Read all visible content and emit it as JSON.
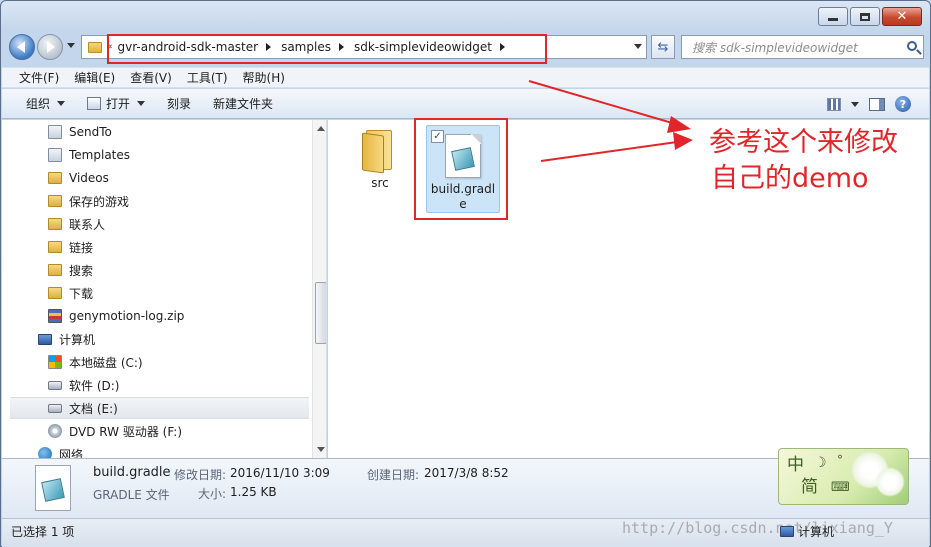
{
  "address": {
    "crumbs": [
      "gvr-android-sdk-master",
      "samples",
      "sdk-simplevideowidget"
    ],
    "overflow_chevron": "«"
  },
  "search": {
    "placeholder": "搜索 sdk-simplevideowidget"
  },
  "menu": [
    "文件(F)",
    "编辑(E)",
    "查看(V)",
    "工具(T)",
    "帮助(H)"
  ],
  "toolbar": {
    "organize": "组织",
    "open": "打开",
    "burn": "刻录",
    "new_folder": "新建文件夹"
  },
  "nav_tree": [
    {
      "label": "SendTo",
      "icon": "shortcut-folder-icon"
    },
    {
      "label": "Templates",
      "icon": "shortcut-folder-icon"
    },
    {
      "label": "Videos",
      "icon": "folder-icon"
    },
    {
      "label": "保存的游戏",
      "icon": "folder-icon"
    },
    {
      "label": "联系人",
      "icon": "folder-icon"
    },
    {
      "label": "链接",
      "icon": "folder-icon"
    },
    {
      "label": "搜索",
      "icon": "folder-icon"
    },
    {
      "label": "下载",
      "icon": "folder-icon"
    },
    {
      "label": "genymotion-log.zip",
      "icon": "zip-icon"
    },
    {
      "label": "计算机",
      "icon": "computer-icon"
    },
    {
      "label": "本地磁盘 (C:)",
      "icon": "windows-drive-icon"
    },
    {
      "label": "软件 (D:)",
      "icon": "drive-icon"
    },
    {
      "label": "文档 (E:)",
      "icon": "drive-icon"
    },
    {
      "label": "DVD RW 驱动器 (F:)",
      "icon": "dvd-icon"
    },
    {
      "label": "网络",
      "icon": "network-icon"
    }
  ],
  "files": [
    {
      "name": "src",
      "type": "folder"
    },
    {
      "name": "build.gradle",
      "type": "file",
      "selected": true,
      "checked": "✓"
    }
  ],
  "annotation": {
    "line1": "参考这个来修改",
    "line2": "自己的demo",
    "color": "#e0262a"
  },
  "details": {
    "name": "build.gradle",
    "type": "GRADLE 文件",
    "modified_label": "修改日期:",
    "modified_value": "2016/11/10 3:09",
    "created_label": "创建日期:",
    "created_value": "2017/3/8 8:52",
    "size_label": "大小:",
    "size_value": "1.25 KB"
  },
  "ime": {
    "mode": "中",
    "variant": "简"
  },
  "status": {
    "selected": "已选择 1 项",
    "location": "计算机"
  },
  "watermark": "http://blog.csdn.net/lixiang_Y"
}
